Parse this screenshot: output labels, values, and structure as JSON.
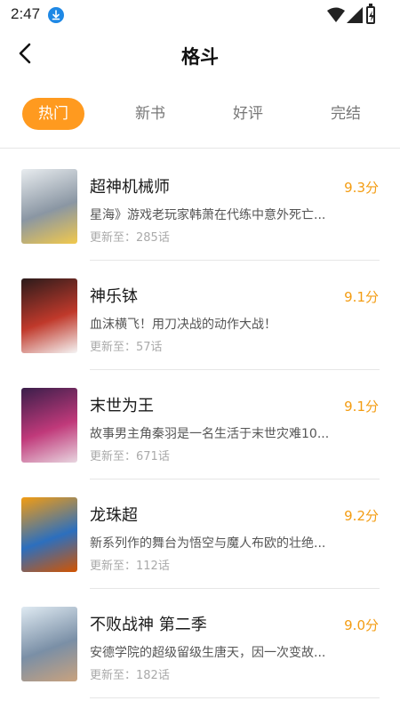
{
  "status_bar": {
    "time": "2:47",
    "icons": [
      "download-icon",
      "wifi-icon",
      "signal-icon",
      "battery-icon"
    ]
  },
  "header": {
    "title": "格斗",
    "back_icon": "back-arrow-icon"
  },
  "tabs": [
    {
      "label": "热门",
      "active": true
    },
    {
      "label": "新书",
      "active": false
    },
    {
      "label": "好评",
      "active": false
    },
    {
      "label": "完结",
      "active": false
    }
  ],
  "colors": {
    "accent": "#ff9a1f",
    "score": "#f39c12",
    "download_icon": "#1e88e5"
  },
  "books": [
    {
      "title": "超神机械师",
      "score": "9.3分",
      "desc": "星海》游戏老玩家韩萧在代练中意外死亡...",
      "update": "更新至：285话",
      "cover_colors": [
        "#e8ecef",
        "#8a96a3",
        "#f2c94c"
      ]
    },
    {
      "title": "神乐钵",
      "score": "9.1分",
      "desc": "血沫横飞！用刀决战的动作大战！",
      "update": "更新至：57话",
      "cover_colors": [
        "#2b1b1b",
        "#c0392b",
        "#f5f5f5"
      ]
    },
    {
      "title": "末世为王",
      "score": "9.1分",
      "desc": "故事男主角秦羽是一名生活于末世灾难10...",
      "update": "更新至：671话",
      "cover_colors": [
        "#3a1e4a",
        "#c0397a",
        "#e8d6e0"
      ]
    },
    {
      "title": "龙珠超",
      "score": "9.2分",
      "desc": "新系列作的舞台为悟空与魔人布欧的壮绝...",
      "update": "更新至：112话",
      "cover_colors": [
        "#f39c12",
        "#2c6fbe",
        "#d35400"
      ]
    },
    {
      "title": "不败战神 第二季",
      "score": "9.0分",
      "desc": "安德学院的超级留级生唐天，因一次变故...",
      "update": "更新至：182话",
      "cover_colors": [
        "#dfeaf2",
        "#7a8fa6",
        "#c9a27e"
      ]
    }
  ]
}
